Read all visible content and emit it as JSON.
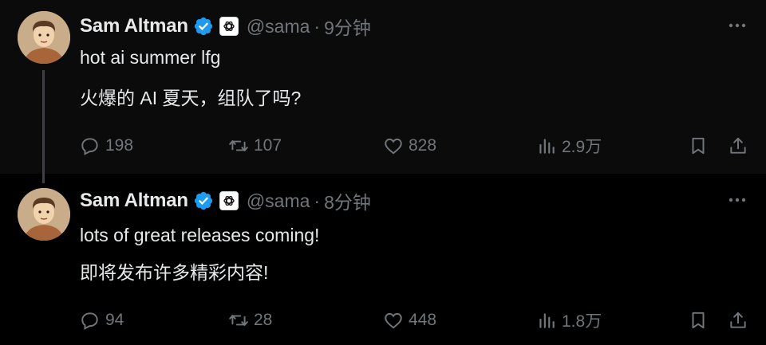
{
  "tweets": [
    {
      "author_name": "Sam Altman",
      "handle": "@sama",
      "separator": "·",
      "time": "9分钟",
      "text_line1": "hot ai summer lfg",
      "text_line2": "火爆的 AI 夏天，组队了吗?",
      "replies": "198",
      "retweets": "107",
      "likes": "828",
      "views": "2.9万"
    },
    {
      "author_name": "Sam Altman",
      "handle": "@sama",
      "separator": "·",
      "time": "8分钟",
      "text_line1": "lots of great releases coming!",
      "text_line2": "即将发布许多精彩内容!",
      "replies": "94",
      "retweets": "28",
      "likes": "448",
      "views": "1.8万"
    }
  ],
  "icons": {
    "verified": "verified-badge-icon",
    "affiliate": "openai-logo-icon",
    "more": "more-icon",
    "reply": "reply-icon",
    "retweet": "retweet-icon",
    "like": "heart-icon",
    "views": "views-icon",
    "bookmark": "bookmark-icon",
    "share": "share-icon"
  },
  "colors": {
    "background": "#000000",
    "thread_background": "#0b0b0c",
    "text": "#e7e9ea",
    "muted": "#71767b",
    "verified_blue": "#1d9bf0"
  }
}
